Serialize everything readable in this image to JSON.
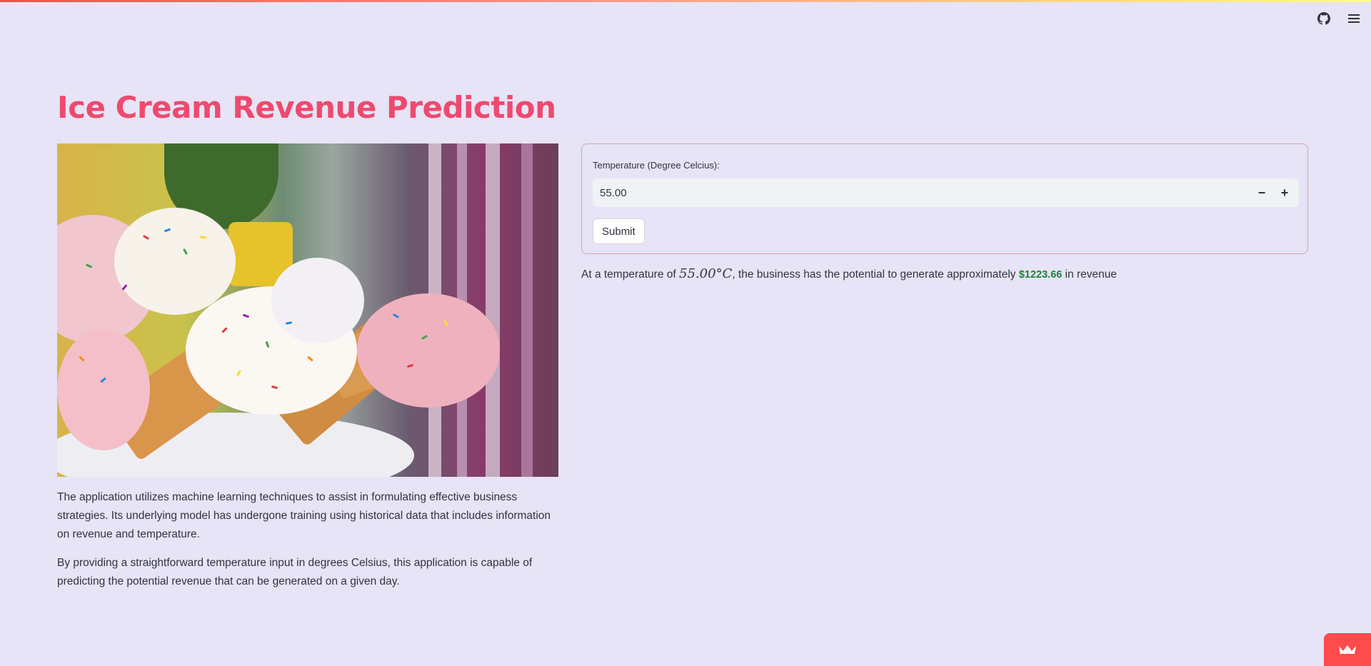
{
  "page": {
    "title": "Ice Cream Revenue Prediction",
    "accent_color": "#ee4a6f",
    "background_color": "#e6e4f6"
  },
  "header": {
    "icons": [
      "github-icon",
      "hamburger-menu-icon"
    ]
  },
  "image": {
    "icon": "ice-cream-cones-photo"
  },
  "description": {
    "paragraph_1": "The application utilizes machine learning techniques to assist in formulating effective business strategies. Its underlying model has undergone training using historical data that includes information on revenue and temperature.",
    "paragraph_2": "By providing a straightforward temperature input in degrees Celsius, this application is capable of predicting the potential revenue that can be generated on a given day."
  },
  "form": {
    "label": "Temperature (Degree Celcius):",
    "value": "55.00",
    "minus_label": "−",
    "plus_label": "+",
    "submit_label": "Submit"
  },
  "result": {
    "prefix": "At a temperature of ",
    "temperature": "55.00°C",
    "middle": ", the business has the potential to generate approximately ",
    "revenue": "$1223.66",
    "suffix": " in revenue",
    "revenue_color": "#21813b"
  },
  "footer": {
    "badge_icon": "streamlit-crown-icon"
  }
}
